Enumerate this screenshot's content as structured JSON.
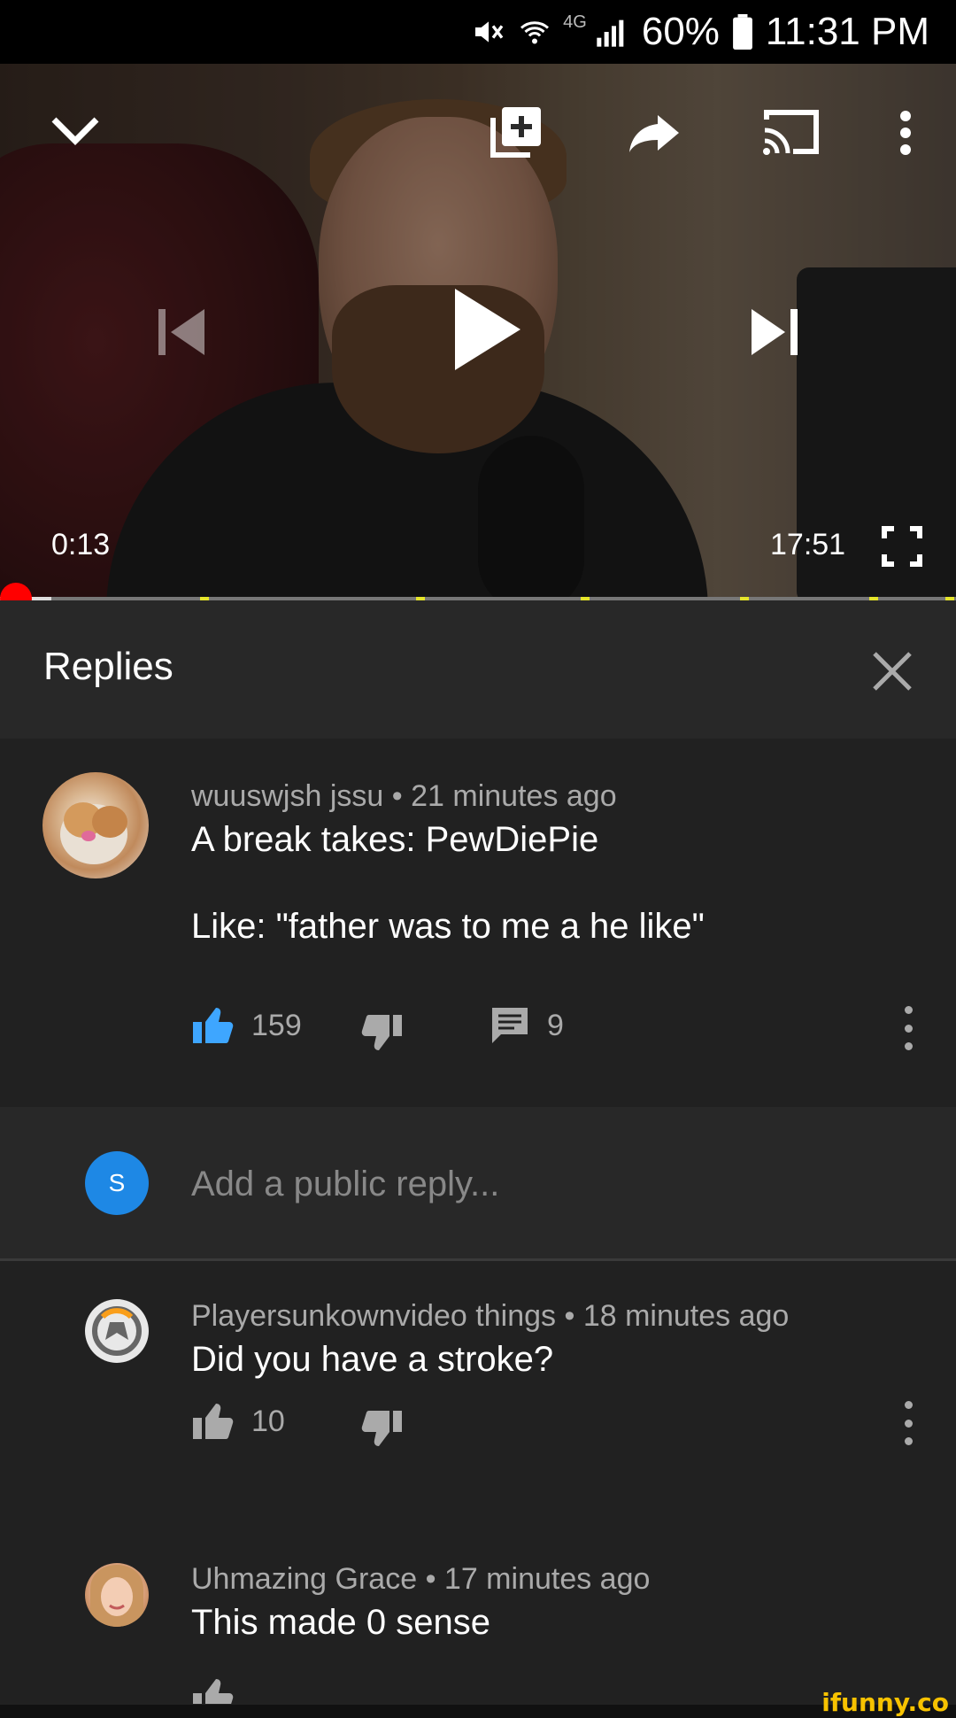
{
  "status_bar": {
    "battery": "60%",
    "time": "11:31 PM",
    "network": "4G",
    "icons": [
      "mute-icon",
      "wifi-icon",
      "signal-icon",
      "battery-icon"
    ]
  },
  "player": {
    "current_time": "0:13",
    "duration": "17:51",
    "played_fraction": 0.012,
    "icons": [
      "chevron-down-icon",
      "add-to-playlist-icon",
      "share-icon",
      "cast-icon",
      "more-vert-icon",
      "previous-icon",
      "play-icon",
      "next-icon",
      "fullscreen-icon"
    ]
  },
  "replies_panel": {
    "title": "Replies",
    "parent_comment": {
      "author": "wuuswjsh jssu",
      "time": "21 minutes ago",
      "text": "A break takes: PewDiePie\n\nLike: \"father was to me a he like\"",
      "likes": "159",
      "replies": "9"
    },
    "reply_box": {
      "avatar_letter": "S",
      "placeholder": "Add a public reply..."
    },
    "replies": [
      {
        "author": "Playersunkownvideo things",
        "time": "18 minutes ago",
        "text": "Did you have a stroke?",
        "likes": "10"
      },
      {
        "author": "Uhmazing Grace",
        "time": "17 minutes ago",
        "text": "This made 0 sense"
      }
    ]
  },
  "colors": {
    "accent_like": "#3ea6ff",
    "progress_red": "#ff0000",
    "panel_bg": "#212121",
    "header_bg": "#282828"
  },
  "watermark": "ifunny.co"
}
